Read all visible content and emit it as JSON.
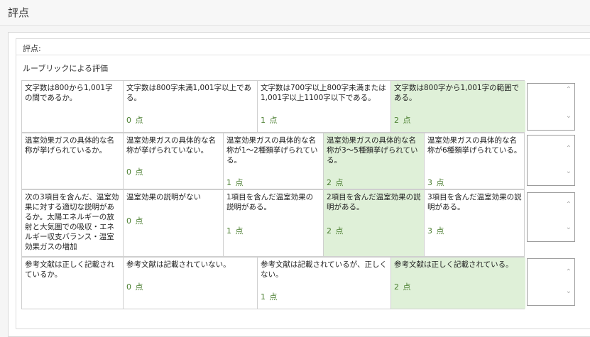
{
  "header": {
    "title": "評点"
  },
  "panel": {
    "score_label": "評点:",
    "rubric_caption": "ルーブリックによる評価"
  },
  "rubric": [
    {
      "criterion": "文字数は800から1,001字の間であるか。",
      "levels": [
        {
          "text": "文字数は800字未満1,001字以上である。",
          "points": "0 点"
        },
        {
          "text": "文字数は700字以上800字未満または1,001字以上1100字以下である。",
          "points": "1 点"
        },
        {
          "text": "文字数は800字から1,001字の範囲である。",
          "points": "2 点",
          "selected": true
        }
      ]
    },
    {
      "criterion": "温室効果ガスの具体的な名称が挙げられているか。",
      "levels": [
        {
          "text": "温室効果ガスの具体的な名称が挙げられていない。",
          "points": "0 点"
        },
        {
          "text": "温室効果ガスの具体的な名称が1～2種類挙げられている。",
          "points": "1 点"
        },
        {
          "text": "温室効果ガスの具体的な名称が3～5種類挙げられている。",
          "points": "2 点",
          "selected": true
        },
        {
          "text": "温室効果ガスの具体的な名称が6種類挙げられている。",
          "points": "3 点"
        }
      ]
    },
    {
      "criterion": "次の3項目を含んだ、温室効果に対する適切な説明があるか。太陽エネルギーの放射と大気圏での吸収・エネルギー収支バランス・温室効果ガスの増加",
      "levels": [
        {
          "text": "温室効果の説明がない",
          "points": "0 点"
        },
        {
          "text": "1項目を含んだ温室効果の説明がある。",
          "points": "1 点"
        },
        {
          "text": "2項目を含んだ温室効果の説明がある。",
          "points": "2 点",
          "selected": true
        },
        {
          "text": "3項目を含んだ温室効果の説明がある。",
          "points": "3 点"
        }
      ]
    },
    {
      "criterion": "参考文献は正しく記載されているか。",
      "levels": [
        {
          "text": "参考文献は記載されていない。",
          "points": "0 点"
        },
        {
          "text": "参考文献は記載されているが、正しくない。",
          "points": "1 点"
        },
        {
          "text": "参考文献は正しく記載されている。",
          "points": "2 点",
          "selected": true
        }
      ]
    }
  ],
  "icons": {
    "scroll_up": "chevron-up-icon",
    "scroll_down": "chevron-down-icon"
  },
  "colors": {
    "selected_bg": "#dff0d8",
    "points_text": "#4a7e2f"
  }
}
